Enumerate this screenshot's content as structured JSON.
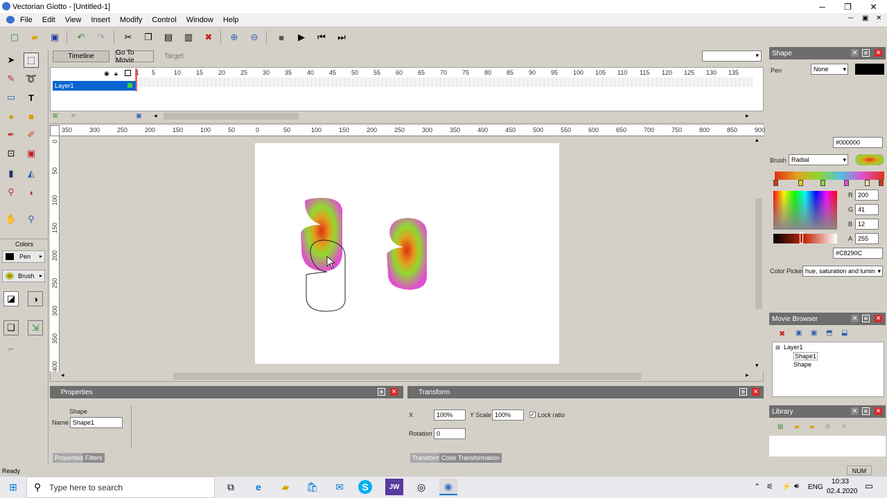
{
  "window": {
    "title": "Vectorian Giotto - [Untitled-1]",
    "minimize": "─",
    "maximize": "❐",
    "close": "✕",
    "inner_min": "─",
    "inner_max": "▣",
    "inner_close": "✕"
  },
  "menu": [
    "File",
    "Edit",
    "View",
    "Insert",
    "Modify",
    "Control",
    "Window",
    "Help"
  ],
  "timeline": {
    "tab_timeline": "Timeline",
    "tab_goto": "Go To Movie",
    "target": "Target",
    "layer": "Layer1",
    "frame_numbers": [
      "1",
      "5",
      "10",
      "15",
      "20",
      "25",
      "30",
      "35",
      "40",
      "45",
      "50",
      "55",
      "60",
      "65",
      "70",
      "75",
      "80",
      "85",
      "90",
      "95",
      "100",
      "105",
      "110",
      "115",
      "120",
      "125",
      "130",
      "135"
    ]
  },
  "ruler_h": [
    "350",
    "300",
    "250",
    "200",
    "150",
    "100",
    "50",
    "0",
    "50",
    "100",
    "150",
    "200",
    "250",
    "300",
    "350",
    "400",
    "450",
    "500",
    "550",
    "600",
    "650",
    "700",
    "750",
    "800",
    "850",
    "900"
  ],
  "ruler_v": [
    "0",
    "50",
    "100",
    "150",
    "200",
    "250",
    "300",
    "350",
    "400"
  ],
  "tools": {
    "colors_label": "Colors",
    "pen_label": "Pen",
    "brush_label": "Brush"
  },
  "shape_panel": {
    "title": "Shape",
    "pen_label": "Pen",
    "pen_value": "None",
    "hex_pen": "#000000",
    "brush_label": "Brush",
    "brush_value": "Radial",
    "r_label": "R",
    "r": "200",
    "g_label": "G",
    "g": "41",
    "b_label": "B",
    "b": "12",
    "a_label": "A",
    "a": "255",
    "hex_brush": "#C8290C",
    "picker_label": "Color Picker",
    "picker_value": "hue, saturation and lumin"
  },
  "movie_browser": {
    "title": "Movie Browser",
    "tree": [
      "Layer1",
      "Shape1",
      "Shape"
    ]
  },
  "library": {
    "title": "Library"
  },
  "properties": {
    "title": "Properties",
    "section": "Shape",
    "name_label": "Name",
    "name_value": "Shape1",
    "tab1": "Properties",
    "tab2": "Filters"
  },
  "transform": {
    "title": "Transform",
    "x_label": "X",
    "x_value": "100%",
    "yscale_label": "Y Scale",
    "yscale_value": "100%",
    "lock_label": "Lock ratio",
    "rotation_label": "Rotation",
    "rotation_value": "0",
    "tab1": "Transform",
    "tab2": "Color Transformation"
  },
  "status": {
    "left": "Ready",
    "right": "NUM"
  },
  "taskbar": {
    "search": "Type here to search",
    "lang": "ENG",
    "time": "10:33",
    "date": "02.4.2020"
  },
  "colors": {
    "accent": "#0078d7",
    "panel_head": "#6d6d6d",
    "brush_red": "#C8290C"
  }
}
